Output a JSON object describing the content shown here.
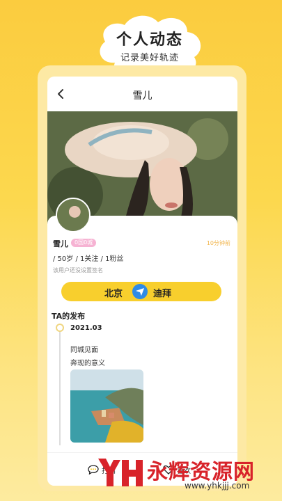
{
  "promo": {
    "title": "个人动态",
    "subtitle": "记录美好轨迹"
  },
  "nav": {
    "back_icon": "chevron-left-icon",
    "title": "雪儿"
  },
  "profile": {
    "name": "雪儿",
    "badge": "0国0城",
    "time": "10分钟前",
    "stats": "/ 50岁 / 1关注 / 1粉丝",
    "signature": "该用户还没设置签名"
  },
  "route": {
    "from": "北京",
    "icon": "airplane-icon",
    "to": "迪拜"
  },
  "posts": {
    "section_title": "TA的发布",
    "date": "2021.03",
    "line1": "同城见面",
    "line2": "奔现的意义"
  },
  "actions": {
    "left_label": "打招",
    "left_icon": "chat-bubble-icon",
    "right_label": "喜欢",
    "right_icon": "heart-icon"
  },
  "watermark": {
    "main": "永辉资源网",
    "url": "www.yhkjjj.com"
  },
  "colors": {
    "background": "#fbcc3f",
    "route_pill": "#f8cf2d",
    "badge": "#f6b3d3",
    "airplane": "#2f8be6",
    "watermark_red": "#d8232a"
  }
}
